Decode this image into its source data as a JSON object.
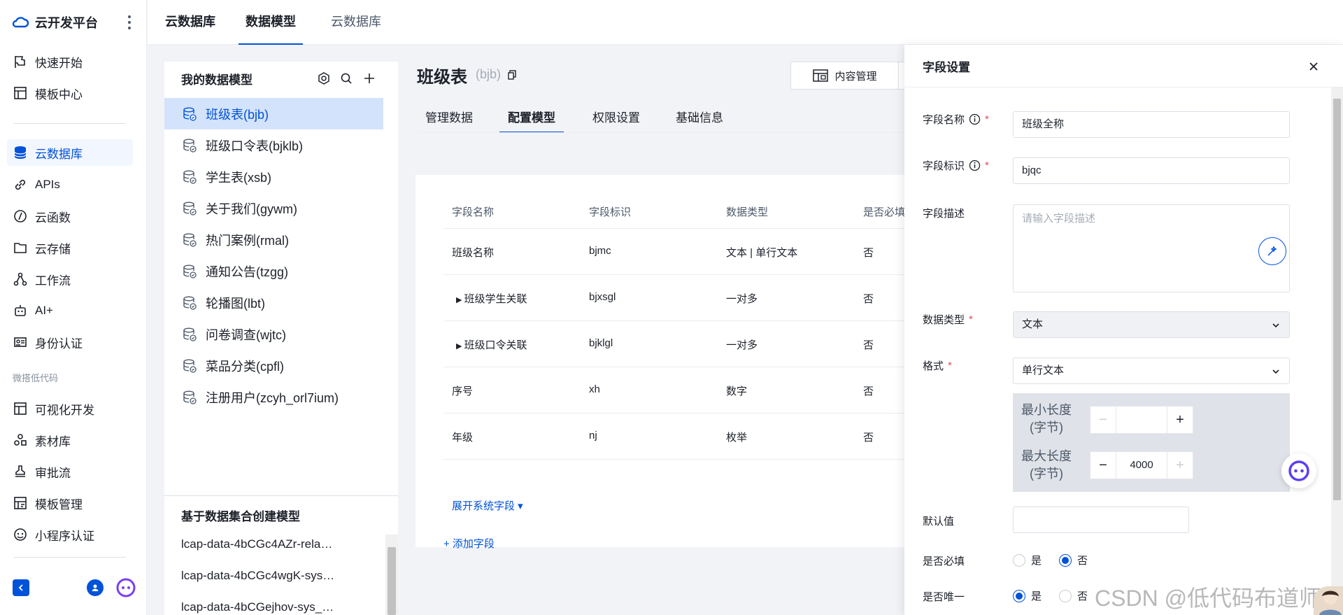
{
  "sidebar": {
    "brand": "云开发平台",
    "items": [
      {
        "label": "快速开始",
        "icon": "flag-icon"
      },
      {
        "label": "模板中心",
        "icon": "template-icon"
      },
      {
        "label": "云数据库",
        "icon": "database-icon",
        "active": true
      },
      {
        "label": "APIs",
        "icon": "link-icon"
      },
      {
        "label": "云函数",
        "icon": "function-icon"
      },
      {
        "label": "云存储",
        "icon": "folder-icon"
      },
      {
        "label": "工作流",
        "icon": "workflow-icon"
      },
      {
        "label": "AI+",
        "icon": "robot-icon"
      },
      {
        "label": "身份认证",
        "icon": "id-card-icon"
      },
      {
        "label": "可视化开发",
        "icon": "layout-icon"
      },
      {
        "label": "素材库",
        "icon": "assets-icon"
      },
      {
        "label": "审批流",
        "icon": "stamp-icon"
      },
      {
        "label": "模板管理",
        "icon": "template-manage-icon"
      },
      {
        "label": "小程序认证",
        "icon": "miniapp-icon"
      }
    ],
    "group_label": "微搭低代码"
  },
  "header": {
    "tabs": [
      "云数据库",
      "数据模型",
      "云数据库"
    ],
    "active_tab": 1
  },
  "models": {
    "title": "我的数据模型",
    "items": [
      "班级表(bjb)",
      "班级口令表(bjklb)",
      "学生表(xsb)",
      "关于我们(gywm)",
      "热门案例(rmal)",
      "通知公告(tzgg)",
      "轮播图(lbt)",
      "问卷调查(wjtc)",
      "菜品分类(cpfl)",
      "注册用户(zcyh_orl7ium)"
    ],
    "active_index": 0,
    "collection_title": "基于数据集合创建模型",
    "collections": [
      "lcap-data-4bCGc4AZr-rela…",
      "lcap-data-4bCGc4wgK-sys…",
      "lcap-data-4bCGejhov-sys_…"
    ]
  },
  "main": {
    "title": "班级表",
    "subtitle": "(bjb)",
    "content_button": "内容管理",
    "tabs": [
      "管理数据",
      "配置模型",
      "权限设置",
      "基础信息"
    ],
    "active_tab": 1,
    "columns": [
      "字段名称",
      "字段标识",
      "数据类型",
      "是否必填"
    ],
    "rows": [
      {
        "name": "班级名称",
        "key": "bjmc",
        "type": "文本 | 单行文本",
        "required": "否",
        "expandable": false
      },
      {
        "name": "班级学生关联",
        "key": "bjxsgl",
        "type": "一对多",
        "required": "否",
        "expandable": true
      },
      {
        "name": "班级口令关联",
        "key": "bjklgl",
        "type": "一对多",
        "required": "否",
        "expandable": true
      },
      {
        "name": "序号",
        "key": "xh",
        "type": "数字",
        "required": "否",
        "expandable": false
      },
      {
        "name": "年级",
        "key": "nj",
        "type": "枚举",
        "required": "否",
        "expandable": false
      }
    ],
    "expand_link": "展开系统字段 ▾",
    "add_link": "+ 添加字段"
  },
  "drawer": {
    "title": "字段设置",
    "name_label": "字段名称",
    "name_value": "班级全称",
    "key_label": "字段标识",
    "key_value": "bjqc",
    "desc_label": "字段描述",
    "desc_placeholder": "请输入字段描述",
    "type_label": "数据类型",
    "type_value": "文本",
    "format_label": "格式",
    "format_value": "单行文本",
    "min_label": "最小长度 (字节)",
    "min_value": "",
    "max_label": "最大长度 (字节)",
    "max_value": "4000",
    "default_label": "默认值",
    "required_label": "是否必填",
    "unique_label": "是否唯一",
    "yes": "是",
    "no": "否",
    "required_value": "否",
    "unique_value": "是"
  },
  "watermark": "CSDN @低代码布道师",
  "colors": {
    "accent": "#0052d9",
    "active_bg": "#d4e3fc",
    "required": "#e34d59"
  }
}
